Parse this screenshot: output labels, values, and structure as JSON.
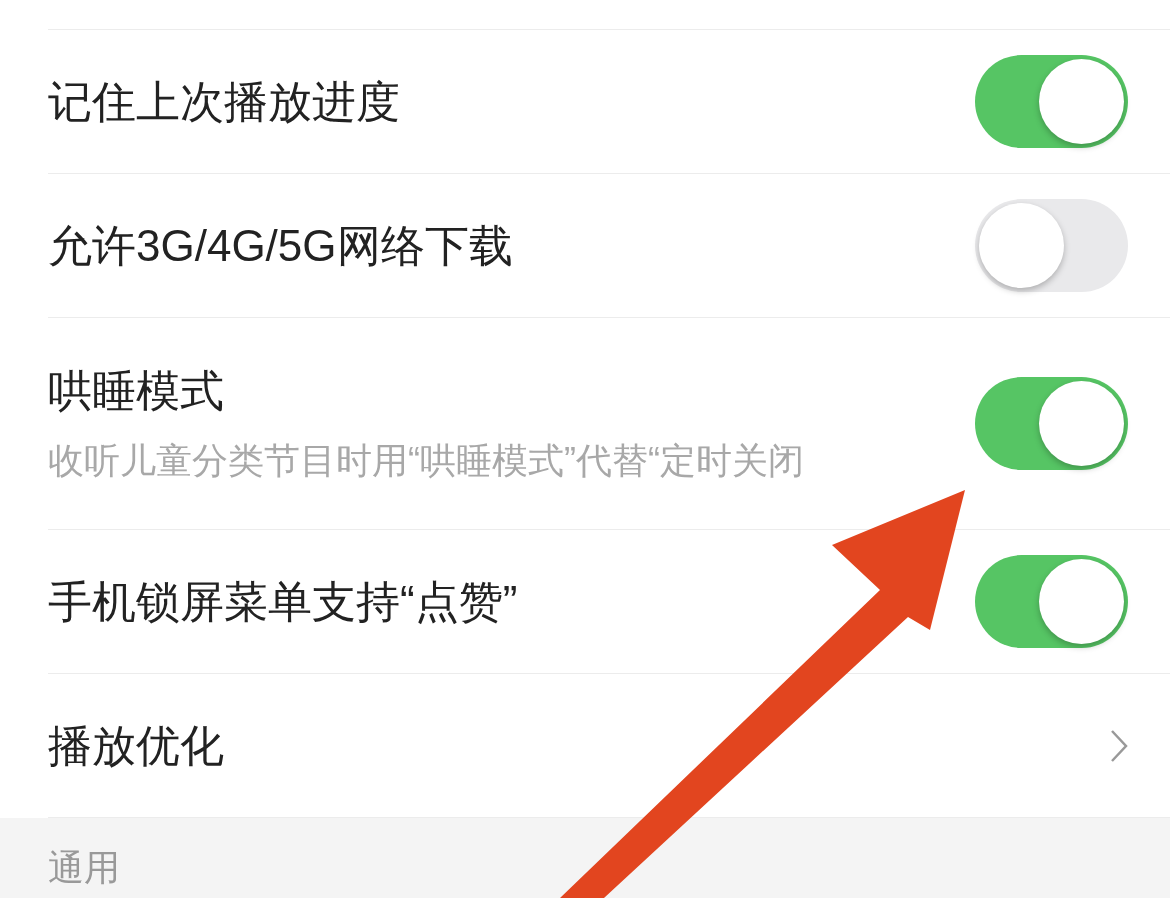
{
  "settings": [
    {
      "kind": "toggle",
      "label": "记住上次播放进度",
      "on": true
    },
    {
      "kind": "toggle",
      "label": "允许3G/4G/5G网络下载",
      "on": false
    },
    {
      "kind": "toggle",
      "label": "哄睡模式",
      "subtitle": "收听儿童分类节目时用“哄睡模式”代替“定时关闭",
      "on": true
    },
    {
      "kind": "toggle",
      "label": "手机锁屏菜单支持“点赞”",
      "on": true
    },
    {
      "kind": "link",
      "label": "播放优化"
    }
  ],
  "section_header": "通用"
}
